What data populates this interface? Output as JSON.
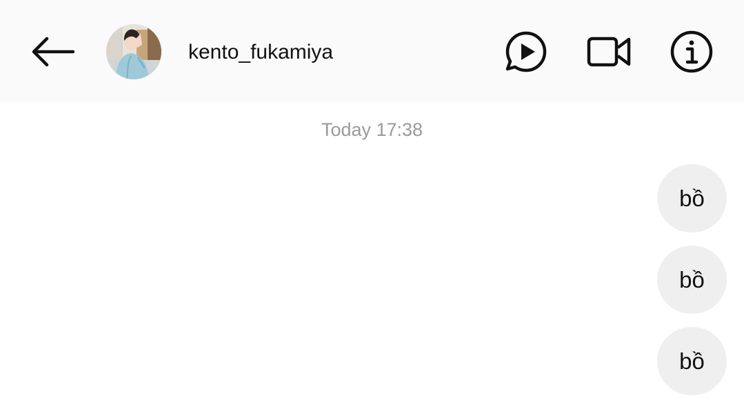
{
  "header": {
    "username": "kento_fukamiya",
    "icons": {
      "back": "arrow-left-icon",
      "avatar": "profile-avatar",
      "play": "play-message-icon",
      "video": "video-call-icon",
      "info": "info-icon"
    }
  },
  "thread": {
    "timestamp": "Today 17:38",
    "messages": [
      {
        "text": "bồ",
        "direction": "sent"
      },
      {
        "text": "bồ",
        "direction": "sent"
      },
      {
        "text": "bồ",
        "direction": "sent"
      }
    ]
  },
  "colors": {
    "header_bg": "#fafafa",
    "page_bg": "#ffffff",
    "bubble_bg": "#efefef",
    "timestamp_text": "#9a9a9a",
    "icon_stroke": "#111111"
  }
}
